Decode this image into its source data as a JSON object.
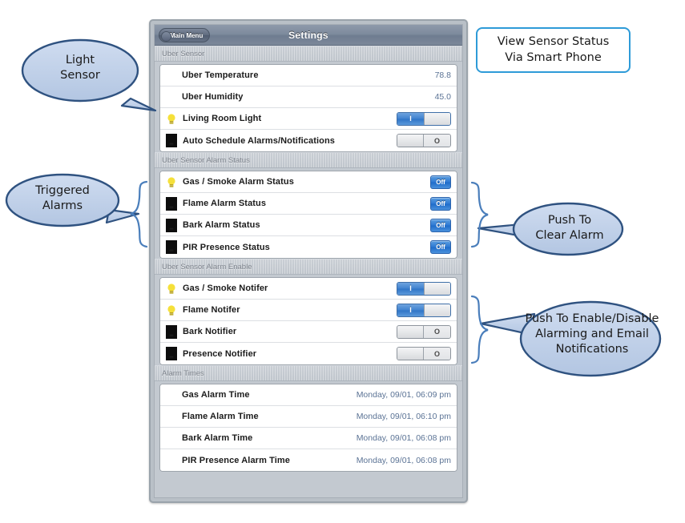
{
  "phone": {
    "titlebar": {
      "back_label": "Main Menu",
      "title": "Settings"
    },
    "sections": [
      {
        "header": "Uber Sensor",
        "rows": [
          {
            "label": "Uber Temperature",
            "value": "78.8",
            "control": "value",
            "icon": "none"
          },
          {
            "label": "Uber Humidity",
            "value": "45.0",
            "control": "value",
            "icon": "none"
          },
          {
            "label": "Living Room Light",
            "control": "switch",
            "state": "on",
            "on_label": "I",
            "off_label": "O",
            "icon": "bulb-on-icon"
          },
          {
            "label": "Auto Schedule Alarms/Notifications",
            "control": "switch",
            "state": "off",
            "on_label": "I",
            "off_label": "O",
            "icon": "bulb-off-icon"
          }
        ]
      },
      {
        "header": "Uber Sensor Alarm Status",
        "rows": [
          {
            "label": "Gas / Smoke Alarm Status",
            "control": "button",
            "button_label": "Off",
            "icon": "bulb-on-icon"
          },
          {
            "label": "Flame Alarm Status",
            "control": "button",
            "button_label": "Off",
            "icon": "bulb-off-icon"
          },
          {
            "label": "Bark Alarm Status",
            "control": "button",
            "button_label": "Off",
            "icon": "bulb-off-icon"
          },
          {
            "label": "PIR Presence Status",
            "control": "button",
            "button_label": "Off",
            "icon": "bulb-off-icon"
          }
        ]
      },
      {
        "header": "Uber Sensor Alarm Enable",
        "rows": [
          {
            "label": "Gas / Smoke Notifer",
            "control": "switch",
            "state": "on",
            "on_label": "I",
            "off_label": "O",
            "icon": "bulb-on-icon"
          },
          {
            "label": "Flame Notifer",
            "control": "switch",
            "state": "on",
            "on_label": "I",
            "off_label": "O",
            "icon": "bulb-on-icon"
          },
          {
            "label": "Bark Notifier",
            "control": "switch",
            "state": "off",
            "on_label": "I",
            "off_label": "O",
            "icon": "bulb-off-icon"
          },
          {
            "label": "Presence Notifier",
            "control": "switch",
            "state": "off",
            "on_label": "I",
            "off_label": "O",
            "icon": "bulb-off-icon"
          }
        ]
      },
      {
        "header": "Alarm Times",
        "rows": [
          {
            "label": "Gas Alarm Time",
            "value": "Monday, 09/01, 06:09 pm",
            "control": "value",
            "icon": "none"
          },
          {
            "label": "Flame Alarm Time",
            "value": "Monday, 09/01, 06:10 pm",
            "control": "value",
            "icon": "none"
          },
          {
            "label": "Bark Alarm Time",
            "value": "Monday, 09/01, 06:08 pm",
            "control": "value",
            "icon": "none"
          },
          {
            "label": "PIR Presence Alarm Time",
            "value": "Monday, 09/01, 06:08 pm",
            "control": "value",
            "icon": "none"
          }
        ]
      }
    ]
  },
  "annotations": {
    "light_sensor": "Light\nSensor",
    "triggered_alarms": "Triggered\nAlarms",
    "view_sensor_status": "View Sensor Status\nVia Smart Phone",
    "push_to_clear": "Push To\nClear Alarm",
    "push_to_enable": "Push To Enable/Disable\nAlarming and Email\nNotifications"
  },
  "colors": {
    "callout_fill": "#c2d2ea",
    "callout_stroke": "#2f5280",
    "rect_stroke": "#2e9bd8",
    "brace_stroke": "#4a7ebb",
    "accent_blue": "#2f7bd4",
    "bulb_on": "#f5e03a",
    "bulb_off": "#0d0d0d"
  }
}
